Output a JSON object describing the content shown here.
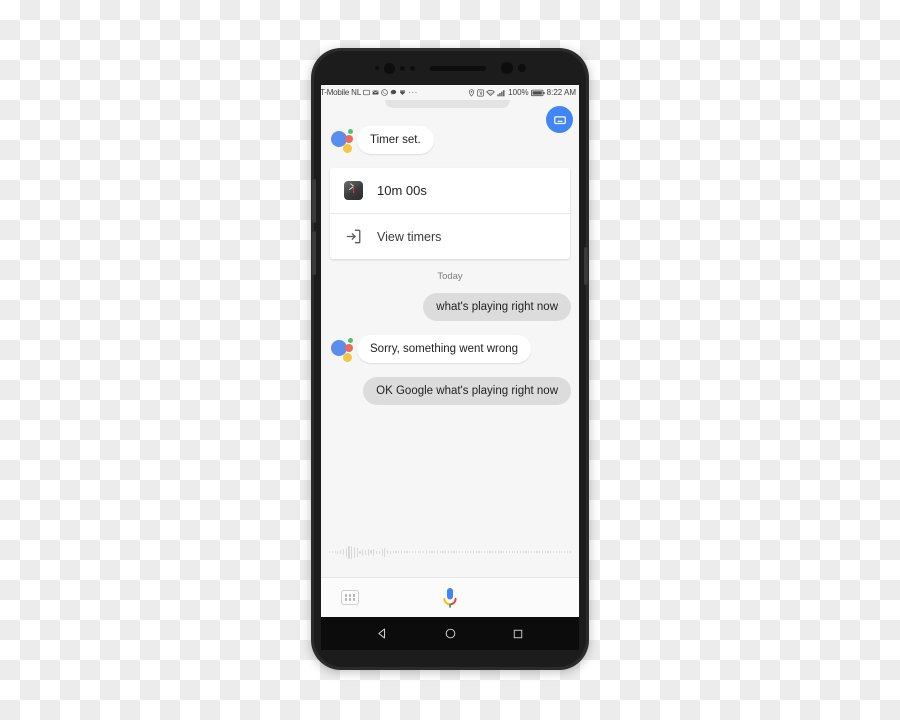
{
  "device": {
    "name": "android-smartphone",
    "bezel_color": "#2b2b2b"
  },
  "status_bar": {
    "carrier": "T-Mobile",
    "network": "NL",
    "notification_icons": [
      "sim-card-icon",
      "email-icon",
      "whatsapp-icon",
      "chat-bubble-icon",
      "app-icon",
      "more-dots-icon"
    ],
    "system_icons": [
      "location-pin-icon",
      "nfc-icon",
      "wifi-icon",
      "signal-bars-icon"
    ],
    "battery_percent": "100%",
    "battery_icon": "battery-full-icon",
    "time": "8:22 AM"
  },
  "header": {
    "keyboard_button": "keyboard-icon",
    "keyboard_button_color": "#4285f4"
  },
  "conversation": {
    "assistant_reply_1": "Timer set.",
    "timer_card": {
      "duration": "10m 00s",
      "duration_icon": "clock-app-icon",
      "action_label": "View timers",
      "action_icon": "open-in-new-icon"
    },
    "day_divider": "Today",
    "messages": [
      {
        "from": "user",
        "text": "what's playing right now"
      },
      {
        "from": "assistant",
        "text": "Sorry, something went wrong"
      },
      {
        "from": "user",
        "text": "OK Google what's playing right now"
      }
    ],
    "waveform_heights": [
      2,
      2,
      2,
      3,
      4,
      6,
      9,
      13,
      13,
      11,
      9,
      3,
      7,
      5,
      7,
      4,
      7,
      3,
      3,
      7,
      9,
      4,
      3,
      2,
      2,
      2,
      2,
      2,
      2,
      2,
      2,
      2,
      2,
      2,
      2,
      2,
      2,
      2,
      2,
      2,
      2,
      2,
      2,
      2,
      2,
      2,
      2,
      2,
      2,
      2,
      2,
      2,
      2,
      2,
      2,
      2,
      2,
      2,
      2,
      2,
      2,
      2,
      2,
      2,
      2,
      2,
      2,
      2,
      2,
      2,
      2,
      2,
      2,
      2,
      2,
      2,
      2,
      2,
      2,
      2,
      2,
      2,
      2,
      2,
      2,
      2,
      2,
      2
    ]
  },
  "bottom_bar": {
    "explore_button": "explore-grid-icon",
    "mic_button": "google-mic-icon"
  },
  "nav_bar": {
    "back": "back-triangle-icon",
    "home": "home-circle-icon",
    "recents": "recents-square-icon"
  },
  "colors": {
    "google_blue": "#4285f4",
    "google_red": "#ea4335",
    "google_yellow": "#fbbc05",
    "google_green": "#34a853",
    "user_bubble": "#dcdcdc",
    "assistant_bubble": "#ffffff",
    "screen_bg": "#f6f6f6"
  }
}
